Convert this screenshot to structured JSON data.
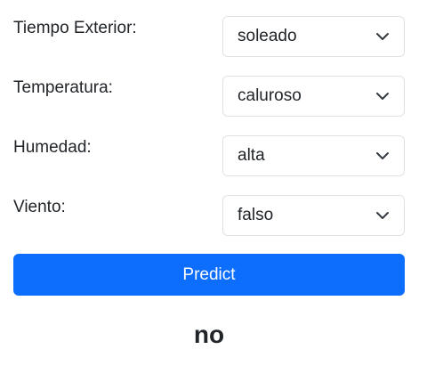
{
  "fields": [
    {
      "label": "Tiempo Exterior:",
      "value": "soleado"
    },
    {
      "label": "Temperatura:",
      "value": "caluroso"
    },
    {
      "label": "Humedad:",
      "value": "alta"
    },
    {
      "label": "Viento:",
      "value": "falso"
    }
  ],
  "button": {
    "label": "Predict",
    "color": "#0d6efd"
  },
  "result": {
    "text": "no"
  },
  "icons": {
    "select_arrow": "chevron-down-icon"
  }
}
